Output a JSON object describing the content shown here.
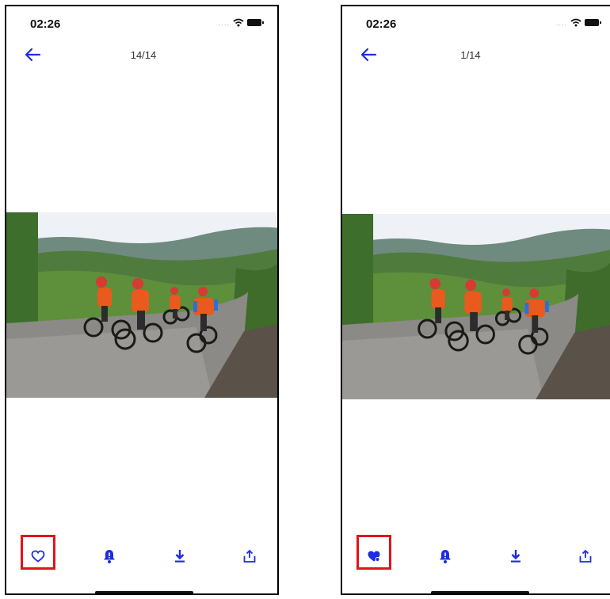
{
  "left_screen": {
    "status_time": "02:26",
    "counter": "14/14",
    "favorite_state": "outline"
  },
  "right_screen": {
    "status_time": "02:26",
    "counter": "1/14",
    "favorite_state": "filled"
  },
  "toolbar_icons": [
    "heart-icon",
    "bell-alert-icon",
    "download-icon",
    "share-icon"
  ],
  "colors": {
    "accent": "#1f2de0",
    "highlight": "#e0141b"
  }
}
